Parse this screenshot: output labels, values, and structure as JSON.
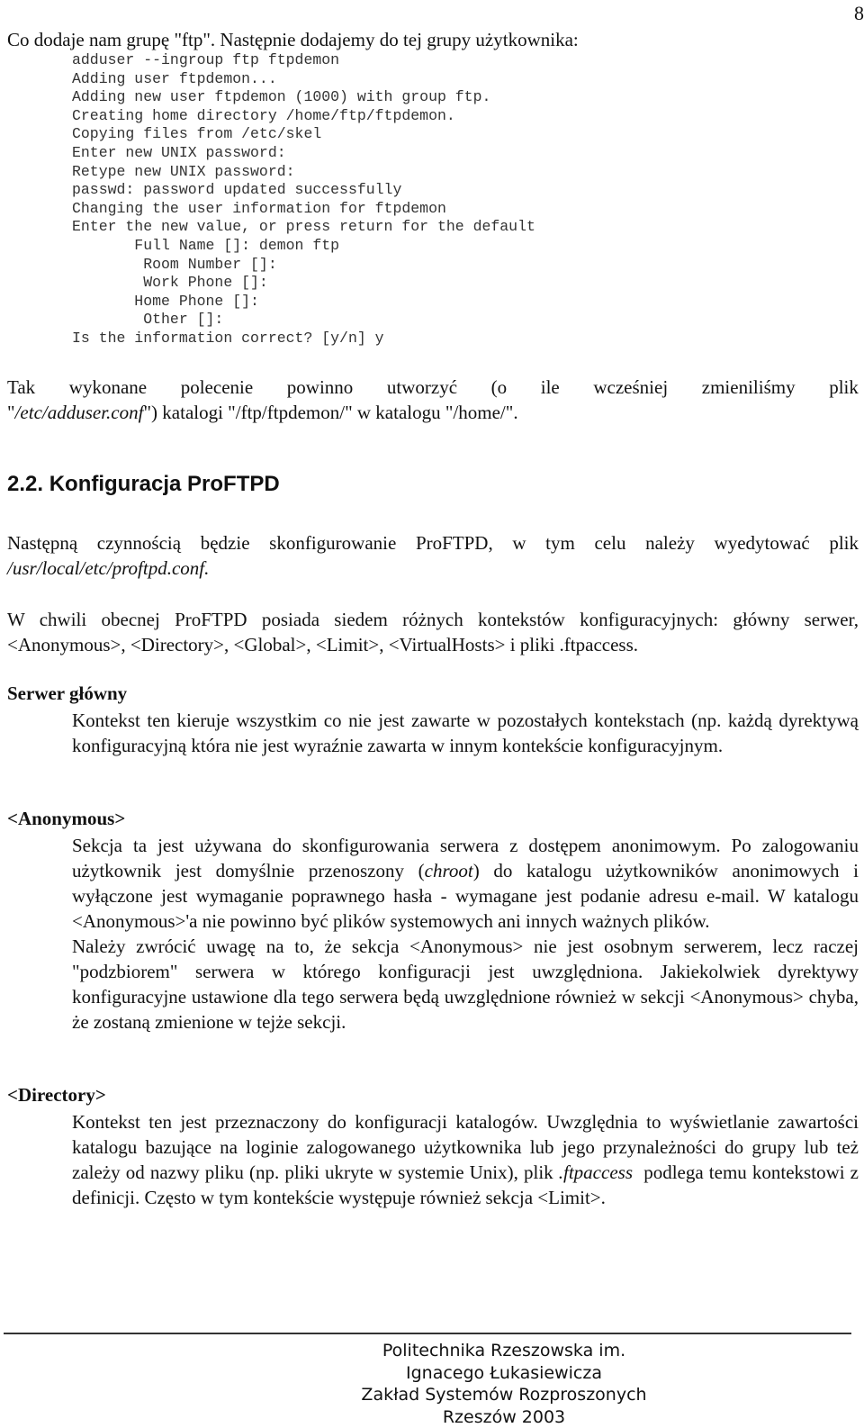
{
  "page_number": "8",
  "intro": "Co dodaje nam grupę \"ftp\". Następnie dodajemy do tej grupy użytkownika:",
  "terminal_lines": [
    "adduser --ingroup ftp ftpdemon",
    "Adding user ftpdemon...",
    "Adding new user ftpdemon (1000) with group ftp.",
    "Creating home directory /home/ftp/ftpdemon.",
    "Copying files from /etc/skel",
    "Enter new UNIX password:",
    "Retype new UNIX password:",
    "passwd: password updated successfully",
    "Changing the user information for ftpdemon",
    "Enter the new value, or press return for the default",
    "       Full Name []: demon ftp",
    "        Room Number []:",
    "        Work Phone []:",
    "       Home Phone []:",
    "        Other []:",
    "Is the information correct? [y/n] y"
  ],
  "para1": {
    "line1_words": [
      "Tak",
      "wykonane",
      "polecenie",
      "powinno",
      "utworzyć",
      "(o",
      "ile",
      "wcześniej",
      "zmieniliśmy",
      "plik"
    ],
    "quote_open": "\"",
    "path_italic": "/etc/adduser.conf",
    "rest": "\") katalogi \"/ftp/ftpdemon/\" w katalogu \"/home/\"."
  },
  "heading": "2.2. Konfiguracja ProFTPD",
  "para2": {
    "text": "Następną czynnością będzie skonfigurowanie ProFTPD, w tym celu należy wyedytować plik",
    "path_italic": "/usr/local/etc/proftpd.conf."
  },
  "para3": "W chwili obecnej ProFTPD posiada siedem różnych kontekstów konfiguracyjnych: główny serwer, <Anonymous>, <Directory>, <Global>, <Limit>, <VirtualHosts> i pliki .ftpaccess.",
  "sections": {
    "main_server": {
      "title": "Serwer główny",
      "body": "Kontekst ten kieruje wszystkim co nie jest zawarte w pozostałych kontekstach (np. każdą dyrektywą konfiguracyjną która nie jest wyraźnie zawarta w innym kontekście konfiguracyjnym."
    },
    "anonymous": {
      "title": "<Anonymous>",
      "body1_a": "Sekcja ta jest używana do skonfigurowania serwera z dostępem anonimowym. Po zalogowaniu użytkownik jest domyślnie przenoszony (",
      "body1_italic": "chroot",
      "body1_b": ") do katalogu użytkowników anonimowych i wyłączone jest wymaganie poprawnego hasła - wymagane jest podanie adresu e-mail. W katalogu <Anonymous>'a nie powinno być plików systemowych ani innych ważnych plików.",
      "body2": "Należy zwrócić uwagę na to, że sekcja <Anonymous> nie jest osobnym serwerem, lecz raczej \"podzbiorem\" serwera w którego konfiguracji jest uwzględniona. Jakiekolwiek dyrektywy konfiguracyjne ustawione dla tego serwera będą uwzględnione również w sekcji <Anonymous> chyba, że zostaną zmienione w tejże sekcji."
    },
    "directory": {
      "title": "<Directory>",
      "body_a": "Kontekst ten jest przeznaczony do konfiguracji katalogów. Uwzględnia to wyświetlanie zawartości katalogu bazujące na loginie zalogowanego użytkownika lub jego przynależności do grupy lub też zależy od nazwy pliku (np. pliki ukryte w systemie Unix), plik ",
      "body_italic": ".ftpaccess",
      "body_b": "  podlega temu kontekstowi z definicji. Często w tym kontekście występuje również sekcja <Limit>."
    }
  },
  "footer": {
    "line1": "Politechnika Rzeszowska im. Ignacego Łukasiewicza",
    "line2": "Zakład Systemów Rozproszonych",
    "line3": "Rzeszów 2003"
  }
}
